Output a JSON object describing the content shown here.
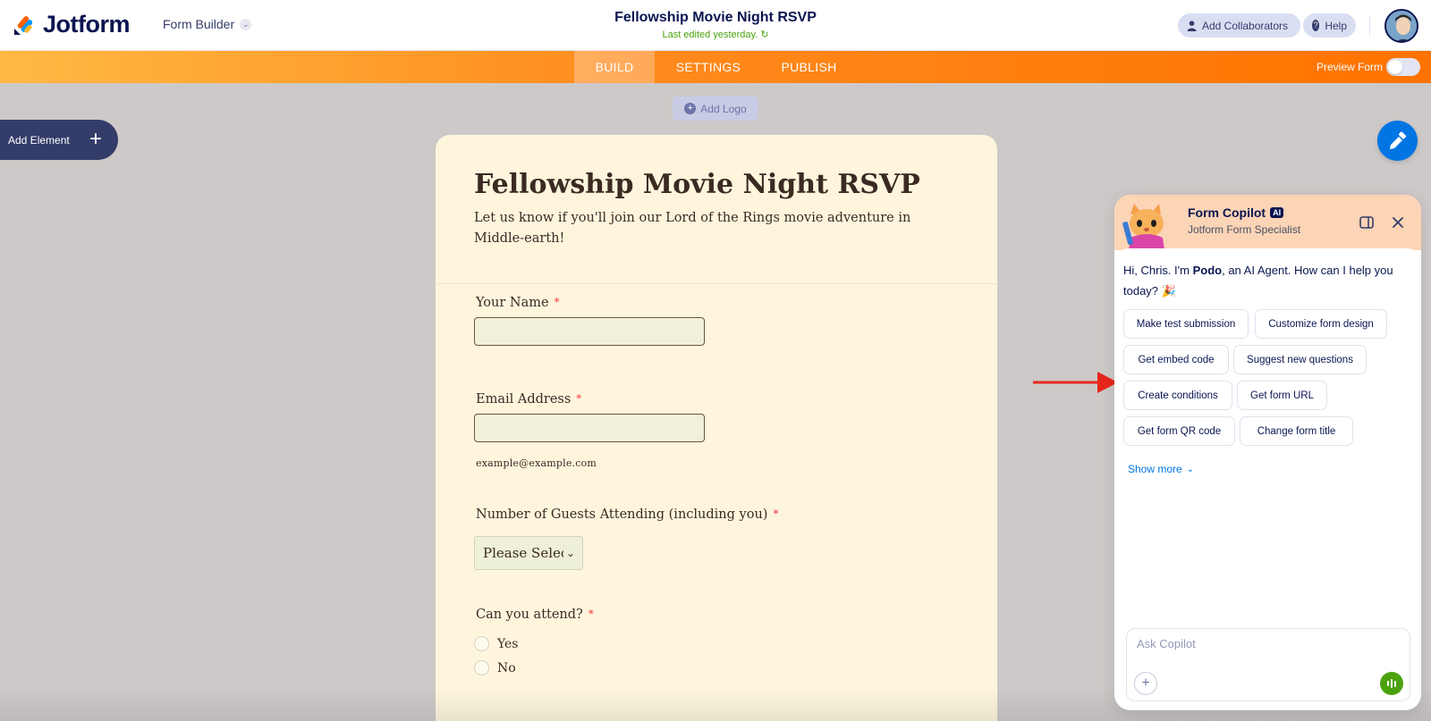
{
  "header": {
    "brand": "Jotform",
    "builder_label": "Form Builder",
    "form_title": "Fellowship Movie Night RSVP",
    "last_edited": "Last edited yesterday.",
    "add_collaborators": "Add Collaborators",
    "help": "Help"
  },
  "nav": {
    "tabs": [
      "BUILD",
      "SETTINGS",
      "PUBLISH"
    ],
    "active_tab": "BUILD",
    "preview_label": "Preview Form",
    "preview_enabled": false,
    "accent_start": "#ffb844",
    "accent_end": "#ff7300"
  },
  "canvas": {
    "add_logo": "Add Logo",
    "add_element": "Add Element"
  },
  "form": {
    "title": "Fellowship Movie Night RSVP",
    "description": "Let us know if you'll join our Lord of the Rings movie adventure in Middle-earth!",
    "fields": {
      "name_label": "Your Name",
      "email_label": "Email Address",
      "email_sublabel": "example@example.com",
      "guests_label": "Number of Guests Attending (including you)",
      "guests_select_value": "Please Select",
      "attend_label": "Can you attend?",
      "attend_options": [
        "Yes",
        "No"
      ],
      "required_mark": "*"
    },
    "background": "#fdf6dd"
  },
  "copilot": {
    "title": "Form Copilot",
    "ai_badge": "AI",
    "subtitle": "Jotform Form Specialist",
    "greeting_prefix": "Hi, Chris. I'm ",
    "greeting_name": "Podo",
    "greeting_suffix": ", an AI Agent. How can I help you today? 🎉",
    "suggestions": [
      "Make test submission",
      "Customize form design",
      "Get embed code",
      "Suggest new questions",
      "Create conditions",
      "Get form URL",
      "Get form QR code",
      "Change form title"
    ],
    "show_more": "Show more",
    "input_placeholder": "Ask Copilot"
  },
  "colors": {
    "navy": "#0a1551",
    "blue": "#0075e3",
    "green": "#4ca20e",
    "annotation_red": "#e8261c"
  }
}
